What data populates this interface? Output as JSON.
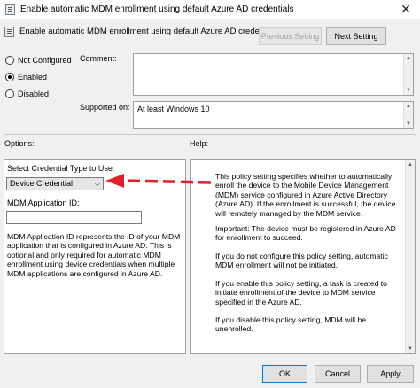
{
  "window": {
    "title": "Enable automatic MDM enrollment using default Azure AD credentials",
    "close_glyph": "✕"
  },
  "header": {
    "title": "Enable automatic MDM enrollment using default Azure AD credentials",
    "previous_label": "Previous Setting",
    "next_label": "Next Setting"
  },
  "state": {
    "options": [
      {
        "label": "Not Configured",
        "checked": false
      },
      {
        "label": "Enabled",
        "checked": true
      },
      {
        "label": "Disabled",
        "checked": false
      }
    ]
  },
  "comment": {
    "label": "Comment:"
  },
  "supported": {
    "label": "Supported on:",
    "value": "At least Windows 10"
  },
  "options_label": "Options:",
  "help_label": "Help:",
  "options_panel": {
    "credential_label": "Select Credential Type to Use:",
    "credential_value": "Device Credential",
    "mdm_app_id_label": "MDM Application ID:",
    "mdm_app_id_value": "",
    "description": "MDM Application ID represents the ID of your MDM application that is configured in Azure AD. This is optional and only required for automatic MDM enrollment using device credentials when multiple MDM applications are configured in Azure AD."
  },
  "help_panel": {
    "paragraphs": [
      "This policy setting specifies whether to automatically enroll the device to the Mobile Device Management (MDM) service configured in Azure Active Directory (Azure AD). If the enrollment is successful, the device will remotely managed by the MDM service.",
      "Important: The device must be registered in Azure AD for enrollment to succeed.",
      "If you do not configure this policy setting, automatic MDM enrollment will not be initiated.",
      "If you enable this policy setting, a task is created to initiate enrollment of the device to MDM service specified in the Azure AD.",
      "If you disable this policy setting, MDM will be unenrolled."
    ]
  },
  "footer": {
    "ok_label": "OK",
    "cancel_label": "Cancel",
    "apply_label": "Apply"
  },
  "colors": {
    "annotation_arrow": "#e0202a",
    "default_button_border": "#0078d7"
  }
}
